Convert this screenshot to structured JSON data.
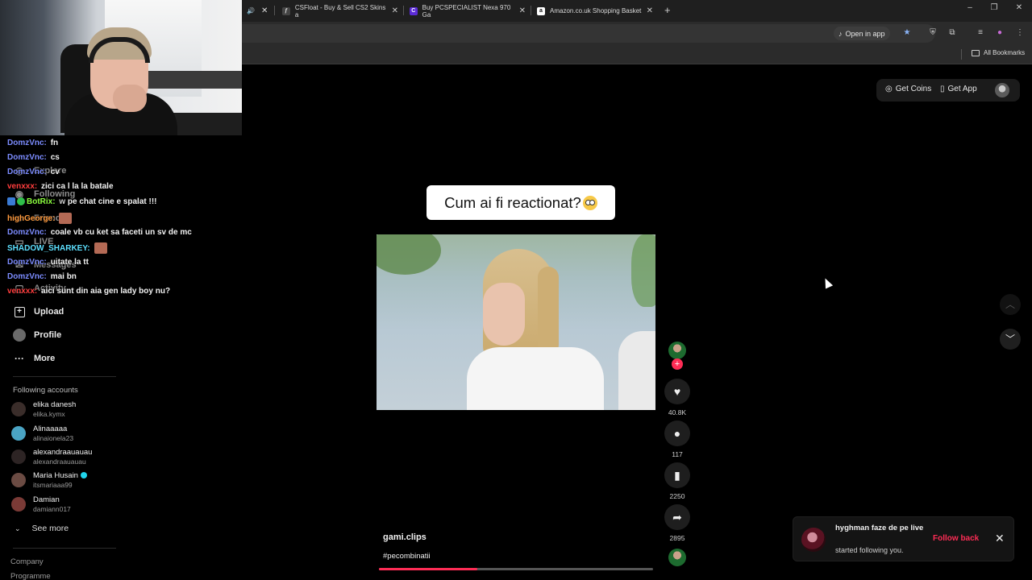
{
  "browser": {
    "tabs": [
      {
        "title": "CSFloat - Buy & Sell CS2 Skins a",
        "favicon": "csfloat-logo",
        "active": false
      },
      {
        "title": "Buy PCSPECIALIST Nexa 970 Ga",
        "favicon": "pcspecialist-logo",
        "active": false
      },
      {
        "title": "Amazon.co.uk Shopping Basket",
        "favicon": "amazon-logo",
        "active": false
      }
    ],
    "open_in_app": "Open in app",
    "all_bookmarks": "All Bookmarks"
  },
  "chat": [
    {
      "user": "DomzVnc:",
      "message": "fn",
      "color": "#7c8cff"
    },
    {
      "user": "DomzVnc:",
      "message": "cs",
      "color": "#7c8cff"
    },
    {
      "user": "DomzVnc:",
      "message": "cv",
      "color": "#7c8cff"
    },
    {
      "user": "venxxx:",
      "message": "zici ca l la la batale",
      "color": "#ff3d3d"
    },
    {
      "user": "BotRix:",
      "message": "pe chat cine e spalat !!!",
      "color": "#8cff3f"
    },
    {
      "user": "highGeorge:",
      "message": "",
      "color": "#ff9a3d"
    },
    {
      "user": "DomzVnc:",
      "message": "coale vb cu ket sa faceti un sv de mc",
      "color": "#7c8cff"
    },
    {
      "user": "SHADOW_SHARKEY:",
      "message": "",
      "color": "#5de0ff"
    },
    {
      "user": "DomzVnc:",
      "message": "uitate la tt",
      "color": "#7c8cff"
    },
    {
      "user": "DomzVnc:",
      "message": "mai bn",
      "color": "#7c8cff"
    },
    {
      "user": "venxxx:",
      "message": "aici sunt din aia gen lady boy nu?",
      "color": "#ff3d3d"
    }
  ],
  "sidebar": {
    "nav": [
      {
        "label": "Explore"
      },
      {
        "label": "Following"
      },
      {
        "label": "Friends"
      },
      {
        "label": "LIVE"
      },
      {
        "label": "Messages"
      },
      {
        "label": "Activity"
      },
      {
        "label": "Upload"
      },
      {
        "label": "Profile"
      },
      {
        "label": "More"
      }
    ],
    "following_title": "Following accounts",
    "accounts": [
      {
        "name": "elika danesh",
        "username": "elika.kymx",
        "color": "#3a2d2a",
        "verified": false
      },
      {
        "name": "Alinaaaaa",
        "username": "alinaionela23",
        "color": "#4aa4c4",
        "verified": false
      },
      {
        "name": "alexandraauauau",
        "username": "alexandraauauau",
        "color": "#2d2424",
        "verified": false
      },
      {
        "name": "Maria Husain",
        "username": "itsmariaaa99",
        "color": "#6b4b43",
        "verified": true
      },
      {
        "name": "Damian",
        "username": "damiann017",
        "color": "#7a3a36",
        "verified": false
      }
    ],
    "see_more": "See more",
    "footer": [
      "Company",
      "Programme"
    ]
  },
  "header": {
    "get_coins": "Get Coins",
    "get_app": "Get App"
  },
  "video": {
    "caption": "Cum ai fi reactionat?",
    "author": "gami.clips",
    "hashtags": "#pecombinatii",
    "progress": 0.36
  },
  "actions": {
    "likes": "40.8K",
    "comments": "117",
    "saves": "2250",
    "shares": "2895"
  },
  "notification": {
    "title": "hyghman faze de pe live",
    "subtitle": "started following you.",
    "action": "Follow back"
  },
  "colors": {
    "accent": "#fe2c55",
    "background": "#000000"
  }
}
